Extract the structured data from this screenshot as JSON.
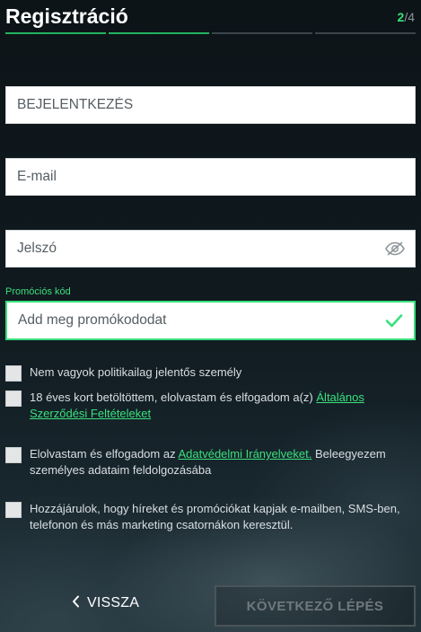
{
  "header": {
    "title": "Regisztráció",
    "step_current": "2",
    "step_total": "/4"
  },
  "progress": {
    "total_steps": 4,
    "completed_steps": 2
  },
  "form": {
    "username_placeholder": "BEJELENTKEZÉS",
    "email_placeholder": "E-mail",
    "password_placeholder": "Jelszó",
    "promo_label": "Promóciós kód",
    "promo_placeholder": "Add meg promókododat"
  },
  "checkboxes": {
    "pep": "Nem vagyok politikailag jelentős személy",
    "terms_text": "18 éves kort betöltöttem, elolvastam és elfogadom a(z) ",
    "terms_link": "Általános Szerződési Feltételeket",
    "privacy_text_before": "Elolvastam és elfogadom az ",
    "privacy_link": "Adatvédelmi Irányelveket.",
    "privacy_text_after": " Beleegyezem személyes adataim feldolgozásába",
    "marketing": "Hozzájárulok, hogy híreket és promóciókat kapjak e-mailben, SMS-ben, telefonon és más marketing csatornákon keresztül."
  },
  "actions": {
    "back_label": "VISSZA",
    "next_label": "KÖVETKEZŐ LÉPÉS"
  },
  "colors": {
    "accent": "#39e07d",
    "progress_done": "#23b25f",
    "next_disabled": "#6f797e"
  },
  "icons": {
    "password_toggle": "eye-off-icon",
    "promo_valid": "check-icon",
    "back": "chevron-left-icon"
  }
}
